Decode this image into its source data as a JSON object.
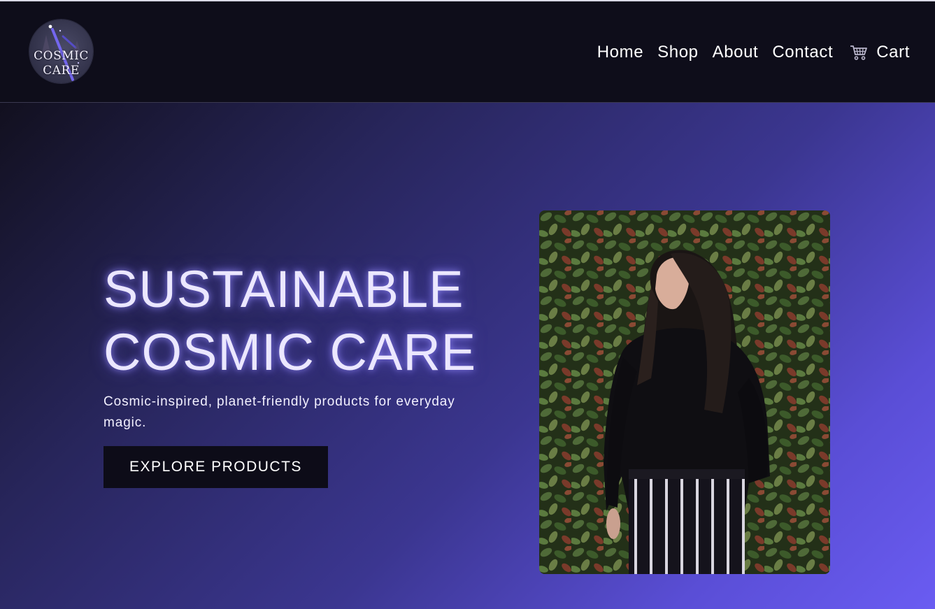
{
  "header": {
    "logo": {
      "line1": "COSMIC",
      "line2": "CARE",
      "icon": "cosmic-logo"
    },
    "nav": [
      {
        "label": "Home"
      },
      {
        "label": "Shop"
      },
      {
        "label": "About"
      },
      {
        "label": "Contact"
      }
    ],
    "cart": {
      "label": "Cart",
      "icon": "shopping-cart-icon"
    }
  },
  "hero": {
    "title_line1": "SUSTAINABLE",
    "title_line2": "COSMIC CARE",
    "subtitle": "Cosmic-inspired, planet-friendly products for everyday magic.",
    "cta_label": "EXPLORE PRODUCTS",
    "image_alt": "Woman in black sweater standing before a leafy hedge"
  },
  "colors": {
    "header_bg": "#0e0d1a",
    "hero_gradient_start": "#12101f",
    "hero_gradient_end": "#6a5cf2",
    "title_glow": "#968cff",
    "button_bg": "#0d0c18"
  }
}
